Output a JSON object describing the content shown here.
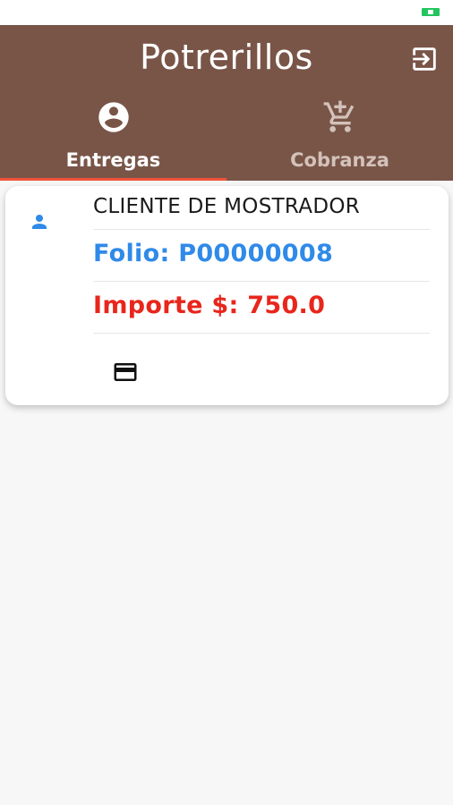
{
  "app": {
    "title": "Potrerillos"
  },
  "header": {
    "logout_icon": "logout-icon"
  },
  "tabs": [
    {
      "label": "Entregas",
      "icon": "account-circle-icon",
      "active": true
    },
    {
      "label": "Cobranza",
      "icon": "add-shopping-cart-icon",
      "active": false
    }
  ],
  "delivery": {
    "client": "CLIENTE DE MOSTRADOR",
    "folio": "Folio: P00000008",
    "importe": "Importe $: 750.0",
    "action_icon": "credit-card-icon"
  },
  "colors": {
    "app_bar": "#795548",
    "tab_indicator": "#f0533a",
    "folio": "#2f8ae8",
    "importe": "#e8261c",
    "battery": "#22c55e"
  }
}
